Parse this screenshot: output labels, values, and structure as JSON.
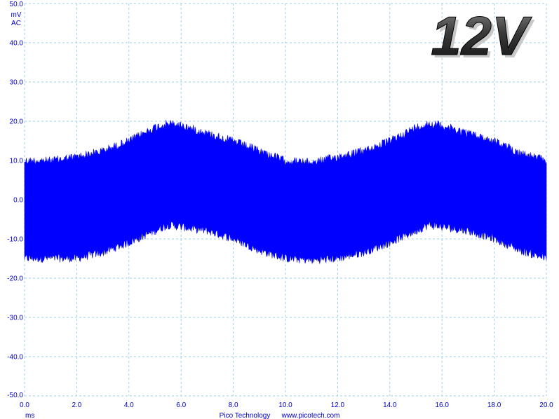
{
  "chart_data": {
    "type": "area",
    "title": "",
    "badge": "12V",
    "xlabel": "ms",
    "ylabel": "mV",
    "coupling": "AC",
    "xlim": [
      0.0,
      20.0
    ],
    "ylim": [
      -50.0,
      50.0
    ],
    "x_ticks": [
      "0.0",
      "2.0",
      "4.0",
      "6.0",
      "8.0",
      "10.0",
      "12.0",
      "14.0",
      "16.0",
      "18.0",
      "20.0"
    ],
    "y_ticks": [
      "50.0",
      "40.0",
      "30.0",
      "20.0",
      "10.0",
      "0.0",
      "-10.0",
      "-20.0",
      "-30.0",
      "-40.0",
      "-50.0"
    ],
    "grid": true,
    "grid_style": "dashed",
    "color": "#0000ff",
    "series": [
      {
        "x": [
          0.0,
          1.0,
          2.0,
          3.0,
          4.0,
          5.0,
          5.5,
          6.0,
          7.0,
          8.0,
          9.0,
          10.0,
          11.0,
          12.0,
          13.0,
          14.0,
          15.0,
          15.5,
          16.0,
          17.0,
          18.0,
          19.0,
          20.0
        ],
        "upper": [
          11,
          11,
          12,
          13.5,
          16,
          19.5,
          20.5,
          20,
          18,
          16,
          13.5,
          11,
          10.5,
          12,
          13.5,
          16,
          19.5,
          20.5,
          20,
          18,
          16,
          13,
          11
        ],
        "lower": [
          -16,
          -16,
          -16,
          -14.5,
          -12,
          -9,
          -7.5,
          -8,
          -9,
          -11,
          -14,
          -16,
          -16.5,
          -16,
          -14.5,
          -12,
          -9,
          -7.5,
          -8,
          -9,
          -11,
          -14,
          -16
        ]
      }
    ]
  },
  "footer": {
    "company": "Pico Technology",
    "website": "www.picotech.com"
  }
}
